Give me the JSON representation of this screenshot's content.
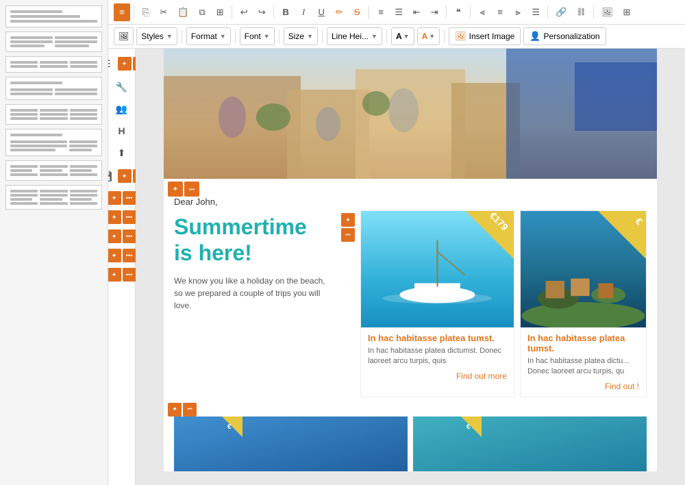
{
  "toolbar": {
    "active_btn": "home",
    "buttons": [
      "undo",
      "redo",
      "cut",
      "copy",
      "paste",
      "paste-special",
      "paste-text",
      "undo2",
      "redo2",
      "bold",
      "italic",
      "underline",
      "highlight",
      "strikethrough",
      "unordered-list",
      "ordered-list",
      "indent-left",
      "indent-right",
      "blockquote",
      "align-left",
      "align-center",
      "align-right",
      "align-justify",
      "link",
      "unlink",
      "image",
      "table"
    ],
    "home_icon": "≡",
    "bold_label": "B",
    "italic_label": "I",
    "underline_label": "U",
    "strikethrough_label": "S"
  },
  "format_toolbar": {
    "styles_label": "Styles",
    "format_label": "Format",
    "font_label": "Font",
    "size_label": "Size",
    "line_height_label": "Line Hei...",
    "font_color_label": "A",
    "bg_color_label": "A",
    "insert_image_label": "Insert Image",
    "personalization_label": "Personalization"
  },
  "side_tools": {
    "items": [
      {
        "icon": "☰",
        "name": "list-view"
      },
      {
        "icon": "🔧",
        "name": "settings"
      },
      {
        "icon": "👥",
        "name": "contacts"
      },
      {
        "icon": "H",
        "name": "heading"
      },
      {
        "icon": "⬆",
        "name": "upload"
      },
      {
        "icon": "💾",
        "name": "save"
      }
    ]
  },
  "email_content": {
    "greeting": "Dear John,",
    "headline_line1": "Summertime",
    "headline_line2": "is here!",
    "body_text": "We know you like a holiday on the beach, so we prepared a couple of trips you will love.",
    "product1": {
      "title": "In hac habitasse platea tumst.",
      "description": "In hac habitasse platea dictumst. Donec laoreet arcu turpis, quis",
      "find_more": "Find out more",
      "price": "€179"
    },
    "product2": {
      "title": "In hac habitasse platea tumst.",
      "description": "In hac habitasse platea dictu... Donec laoreet arcu turpis, qu",
      "find_more": "Find out !",
      "price": "€"
    }
  },
  "left_sidebar": {
    "templates": [
      "single-col-header",
      "two-col-text",
      "three-col",
      "two-col-mixed",
      "three-col-equal",
      "two-col-unequal",
      "three-col-content",
      "three-col-footer"
    ]
  }
}
